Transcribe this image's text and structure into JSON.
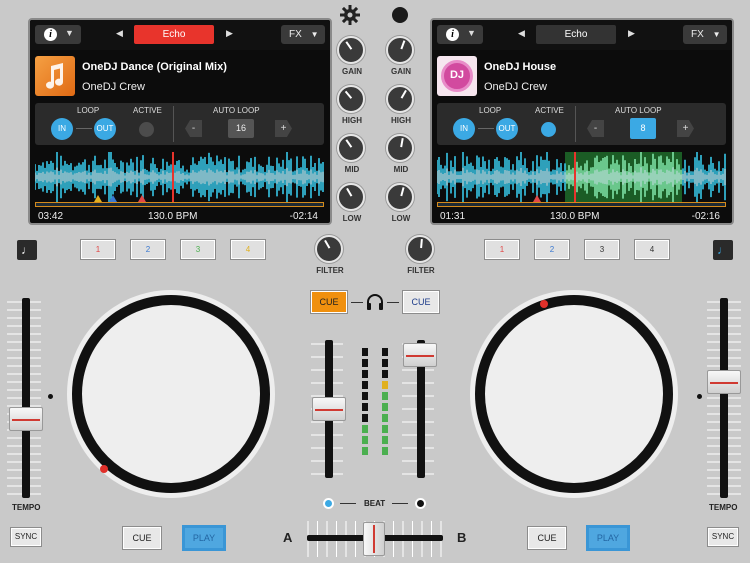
{
  "colors": {
    "accent": "#3ba9e4",
    "fx_active": "#e8342c",
    "cue_active": "#f0900e",
    "marker": "#e0302a"
  },
  "deck_left": {
    "fx_name": "Echo",
    "fx_button": "FX",
    "art_icon": "music-note-icon",
    "title": "OneDJ Dance (Original Mix)",
    "artist": "OneDJ Crew",
    "loop_label": "LOOP",
    "in_label": "IN",
    "out_label": "OUT",
    "active_label": "ACTIVE",
    "auto_loop_label": "AUTO LOOP",
    "minus": "-",
    "plus": "+",
    "auto_loop_value": "16",
    "elapsed": "03:42",
    "bpm": "130.0 BPM",
    "remaining": "-02:14"
  },
  "deck_right": {
    "fx_name": "Echo",
    "fx_button": "FX",
    "art_text": "DJ",
    "title": "OneDJ House",
    "artist": "OneDJ Crew",
    "loop_label": "LOOP",
    "in_label": "IN",
    "out_label": "OUT",
    "active_label": "ACTIVE",
    "auto_loop_label": "AUTO LOOP",
    "minus": "-",
    "plus": "+",
    "auto_loop_value": "8",
    "elapsed": "01:31",
    "bpm": "130.0 BPM",
    "remaining": "-02:16"
  },
  "mixer": {
    "gain": "GAIN",
    "high": "HIGH",
    "mid": "MID",
    "low": "LOW",
    "filter": "FILTER",
    "cue_left": "CUE",
    "cue_right": "CUE",
    "beat": "BEAT",
    "crossfader_a": "A",
    "crossfader_b": "B"
  },
  "pads_left": [
    "1",
    "2",
    "3",
    "4"
  ],
  "pads_right": [
    "1",
    "2",
    "3",
    "4"
  ],
  "pad_colors": [
    "#e04848",
    "#3a78d0",
    "#4caf50",
    "#e0b020"
  ],
  "transport": {
    "tempo": "TEMPO",
    "sync": "SYNC",
    "cue": "CUE",
    "play": "PLAY"
  }
}
